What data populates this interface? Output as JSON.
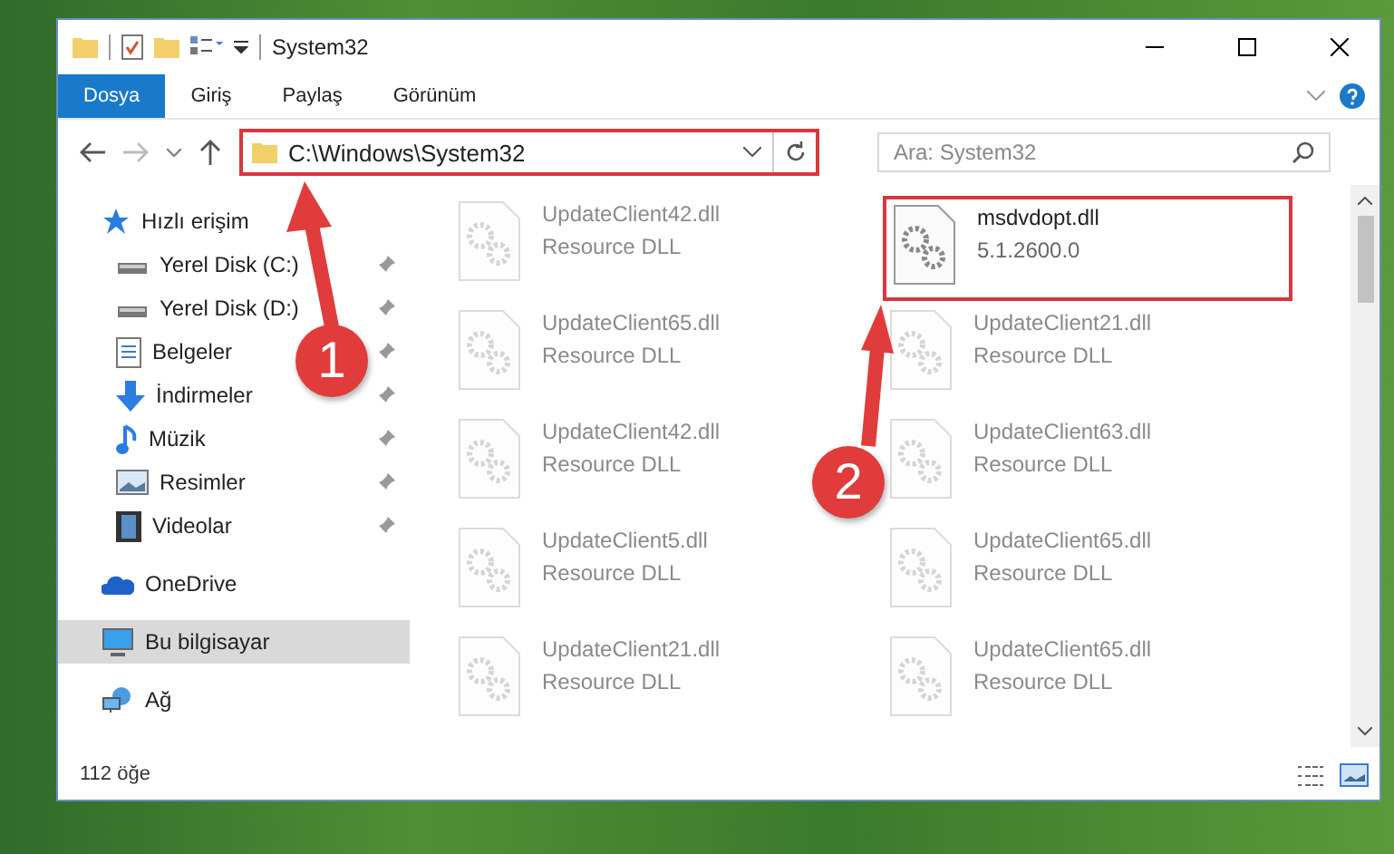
{
  "window": {
    "title": "System32"
  },
  "ribbon": {
    "tabs": [
      {
        "label": "Dosya",
        "selected": true
      },
      {
        "label": "Giriş",
        "selected": false
      },
      {
        "label": "Paylaş",
        "selected": false
      },
      {
        "label": "Görünüm",
        "selected": false
      }
    ]
  },
  "address": {
    "path": "C:\\Windows\\System32",
    "highlighted": true
  },
  "search": {
    "placeholder": "Ara: System32"
  },
  "nav": {
    "items": [
      {
        "label": "Hızlı erişim",
        "selected": false,
        "children": [
          {
            "label": "Yerel Disk (C:)",
            "pinned": true,
            "selected": false
          },
          {
            "label": "Yerel Disk (D:)",
            "pinned": true,
            "selected": false
          },
          {
            "label": "Belgeler",
            "pinned": true,
            "selected": false
          },
          {
            "label": "İndirmeler",
            "pinned": true,
            "selected": false
          },
          {
            "label": "Müzik",
            "pinned": true,
            "selected": false
          },
          {
            "label": "Resimler",
            "pinned": true,
            "selected": false
          },
          {
            "label": "Videolar",
            "pinned": true,
            "selected": false
          }
        ]
      },
      {
        "label": "OneDrive",
        "selected": false
      },
      {
        "label": "Bu bilgisayar",
        "selected": true
      },
      {
        "label": "Ağ",
        "selected": false
      }
    ]
  },
  "files": [
    {
      "name": "UpdateClient42.dll",
      "description": "Resource DLL",
      "dimmed": true,
      "highlighted": false
    },
    {
      "name": "msdvdopt.dll",
      "description": "5.1.2600.0",
      "dimmed": false,
      "highlighted": true
    },
    {
      "name": "UpdateClient65.dll",
      "description": "Resource DLL",
      "dimmed": true,
      "highlighted": false
    },
    {
      "name": "UpdateClient21.dll",
      "description": "Resource DLL",
      "dimmed": true,
      "highlighted": false
    },
    {
      "name": "UpdateClient42.dll",
      "description": "Resource DLL",
      "dimmed": true,
      "highlighted": false
    },
    {
      "name": "UpdateClient63.dll",
      "description": "Resource DLL",
      "dimmed": true,
      "highlighted": false
    },
    {
      "name": "UpdateClient5.dll",
      "description": "Resource DLL",
      "dimmed": true,
      "highlighted": false
    },
    {
      "name": "UpdateClient65.dll",
      "description": "Resource DLL",
      "dimmed": true,
      "highlighted": false
    },
    {
      "name": "UpdateClient21.dll",
      "description": "Resource DLL",
      "dimmed": true,
      "highlighted": false
    },
    {
      "name": "UpdateClient65.dll",
      "description": "Resource DLL",
      "dimmed": true,
      "highlighted": false
    }
  ],
  "status_bar": {
    "count": "112 öğe"
  },
  "annotations": [
    {
      "number": "1"
    },
    {
      "number": "2"
    }
  ]
}
